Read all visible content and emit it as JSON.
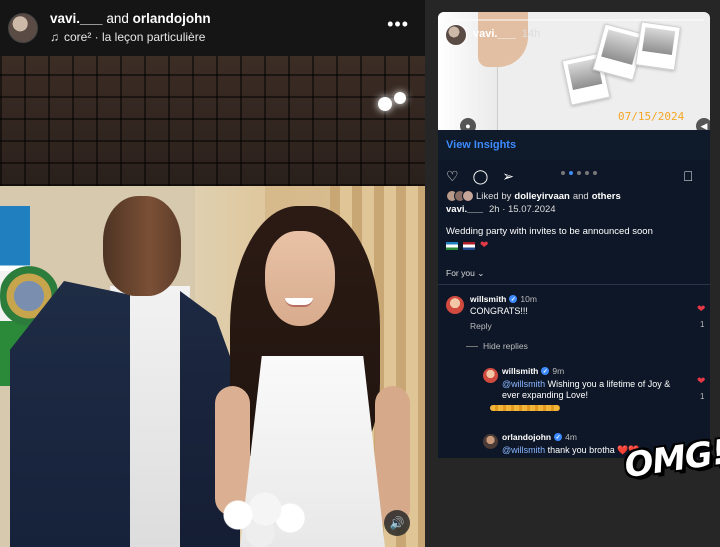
{
  "left_post": {
    "header": {
      "user1": "vavi.___",
      "connector": "and",
      "user2": "orlandojohn",
      "song": "core² · la leçon particulière"
    },
    "icons": {
      "more": "more-horizontal-icon",
      "music": "music-note-icon",
      "sound": "speaker-icon"
    }
  },
  "story": {
    "username": "vavi.___",
    "time": "14h",
    "date_stamp": "07/15/2024",
    "view_insights": "View Insights",
    "post": {
      "liked_prefix": "Liked by",
      "liked_user": "dolleyirvaan",
      "liked_and": "and",
      "liked_others": "others",
      "username": "vavi.___",
      "meta_time": "2h · 15.07.2024",
      "caption": "Wedding party with invites to be announced soon",
      "for_you": "For you"
    },
    "comments": [
      {
        "user": "willsmith",
        "time": "10m",
        "text": "CONGRATS!!!",
        "reply": "Reply",
        "likes": "1"
      },
      {
        "user": "willsmith",
        "time": "9m",
        "mention": "@willsmith",
        "text": "Wishing you a lifetime of Joy & ever expanding Love!",
        "likes": "1"
      },
      {
        "user": "orlandojohn",
        "time": "4m",
        "mention": "@willsmith",
        "text": "thank you brotha ❤️❤️"
      }
    ],
    "hide_replies": "Hide replies",
    "carousel": {
      "total": 5,
      "active": 2
    }
  },
  "sticker": {
    "text": "OMG!"
  },
  "colors": {
    "link_blue": "#3d8bff",
    "heart_red": "#e63946",
    "panel": "#0e1727"
  }
}
